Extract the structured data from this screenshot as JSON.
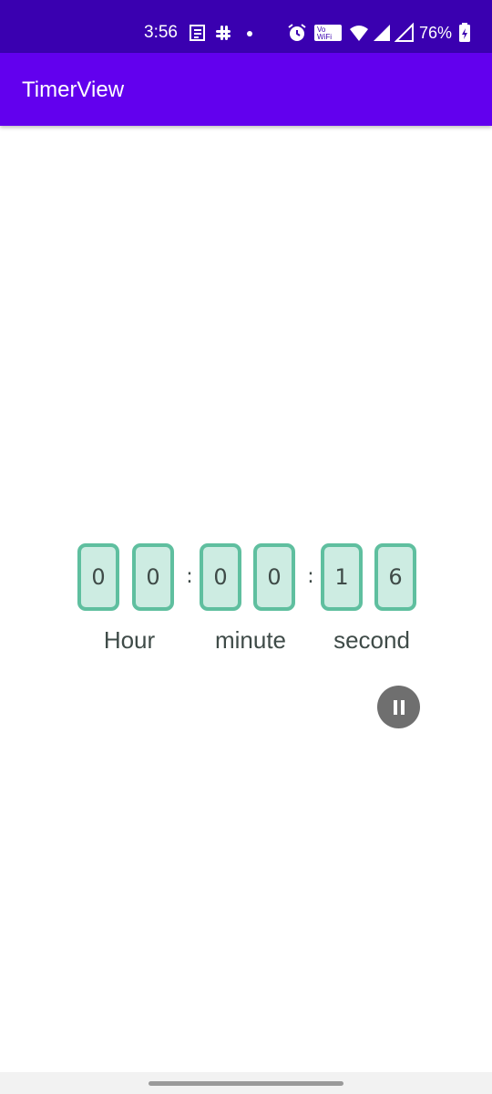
{
  "status_bar": {
    "time": "3:56",
    "battery_percent": "76%",
    "wifi_badge_top": "Vo",
    "wifi_badge_bottom": "WiFi",
    "icons": [
      "notes-icon",
      "slack-icon",
      "dot-icon",
      "alarm-icon",
      "vowifi-icon",
      "wifi-icon",
      "signal-icon",
      "signal-icon-2",
      "battery-icon"
    ]
  },
  "app_bar": {
    "title": "TimerView"
  },
  "timer": {
    "hour_digits": [
      "0",
      "0"
    ],
    "minute_digits": [
      "0",
      "0"
    ],
    "second_digits": [
      "1",
      "6"
    ],
    "separator": ":",
    "labels": {
      "hour": "Hour",
      "minute": "minute",
      "second": "second"
    }
  },
  "controls": {
    "pause_icon": "pause-icon"
  },
  "colors": {
    "status_bar": "#3a00b0",
    "app_bar": "#6200ee",
    "digit_border": "#5fbf9f",
    "digit_fill": "#cdece2",
    "text": "#3f4b48",
    "pause_button": "#6f6f6f"
  }
}
